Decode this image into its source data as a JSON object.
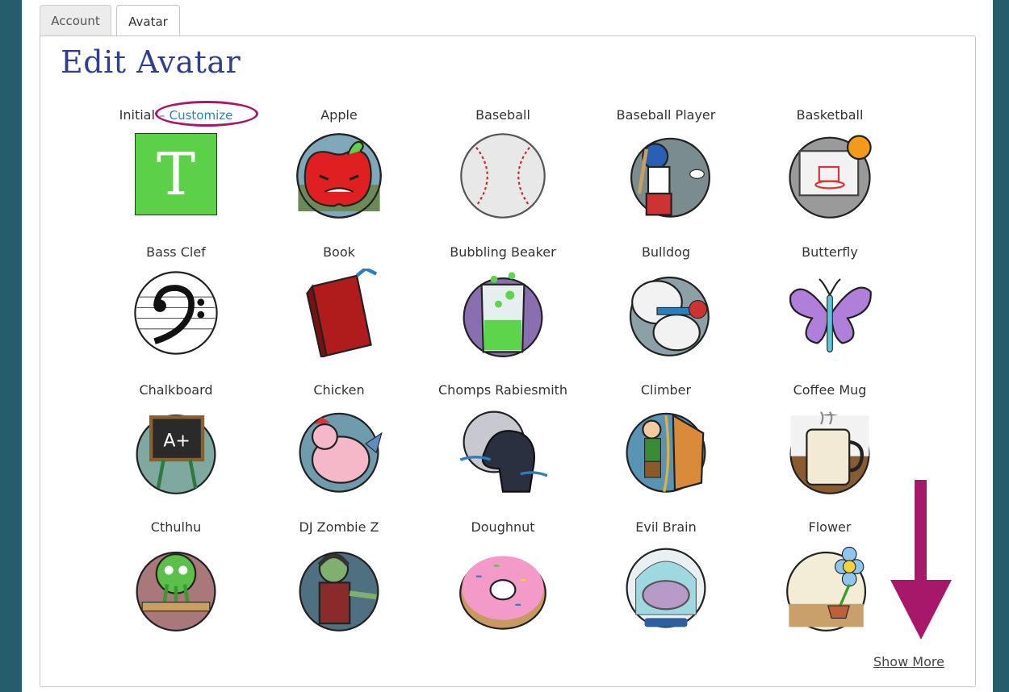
{
  "tabs": [
    {
      "label": "Account",
      "active": false
    },
    {
      "label": "Avatar",
      "active": true
    }
  ],
  "title": "Edit Avatar",
  "initial": {
    "label": "Initial",
    "separator": "–",
    "customize": "Customize",
    "letter": "T",
    "color": "#5dd04a"
  },
  "avatars": [
    {
      "label": "Apple",
      "icon": "apple-icon"
    },
    {
      "label": "Baseball",
      "icon": "baseball-icon"
    },
    {
      "label": "Baseball Player",
      "icon": "baseball-player-icon"
    },
    {
      "label": "Basketball",
      "icon": "basketball-icon"
    },
    {
      "label": "Bass Clef",
      "icon": "bass-clef-icon"
    },
    {
      "label": "Book",
      "icon": "book-icon"
    },
    {
      "label": "Bubbling Beaker",
      "icon": "beaker-icon"
    },
    {
      "label": "Bulldog",
      "icon": "bulldog-icon"
    },
    {
      "label": "Butterfly",
      "icon": "butterfly-icon"
    },
    {
      "label": "Chalkboard",
      "icon": "chalkboard-icon"
    },
    {
      "label": "Chicken",
      "icon": "chicken-icon"
    },
    {
      "label": "Chomps Rabiesmith",
      "icon": "werewolf-icon"
    },
    {
      "label": "Climber",
      "icon": "climber-icon"
    },
    {
      "label": "Coffee Mug",
      "icon": "coffee-mug-icon"
    },
    {
      "label": "Cthulhu",
      "icon": "cthulhu-icon"
    },
    {
      "label": "DJ Zombie Z",
      "icon": "zombie-icon"
    },
    {
      "label": "Doughnut",
      "icon": "doughnut-icon"
    },
    {
      "label": "Evil Brain",
      "icon": "brain-icon"
    },
    {
      "label": "Flower",
      "icon": "flower-icon"
    }
  ],
  "show_more": "Show More",
  "colors": {
    "title": "#2f3f8f",
    "link": "#2b7fbf",
    "annotation": "#a8186a",
    "background": "#255e6a"
  }
}
